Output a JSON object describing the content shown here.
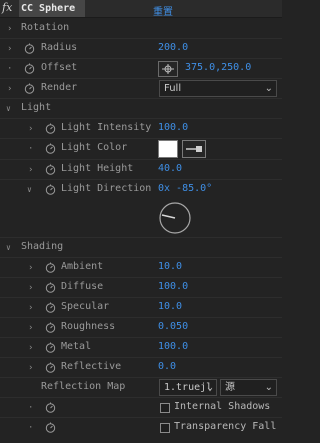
{
  "header": {
    "fx": "fx",
    "title": "CC Sphere",
    "reset": "重置"
  },
  "rotation": {
    "label": "Rotation"
  },
  "radius": {
    "label": "Radius",
    "value": "200.0"
  },
  "offset": {
    "label": "Offset",
    "value": "375.0,250.0"
  },
  "render": {
    "label": "Render",
    "value": "Full"
  },
  "light": {
    "label": "Light"
  },
  "light_intensity": {
    "label": "Light Intensity",
    "value": "100.0"
  },
  "light_color": {
    "label": "Light Color",
    "swatch": "#ffffff"
  },
  "light_height": {
    "label": "Light Height",
    "value": "40.0"
  },
  "light_direction": {
    "label": "Light Direction",
    "value": "0x -85.0°"
  },
  "shading": {
    "label": "Shading"
  },
  "ambient": {
    "label": "Ambient",
    "value": "10.0"
  },
  "diffuse": {
    "label": "Diffuse",
    "value": "100.0"
  },
  "specular": {
    "label": "Specular",
    "value": "10.0"
  },
  "roughness": {
    "label": "Roughness",
    "value": "0.050"
  },
  "metal": {
    "label": "Metal",
    "value": "100.0"
  },
  "reflective": {
    "label": "Reflective",
    "value": "0.0"
  },
  "reflection_map": {
    "label": "Reflection Map",
    "layer": "1.truejl",
    "source": "源"
  },
  "internal_shadows": {
    "label": "Internal Shadows"
  },
  "transparency_falloff": {
    "label": "Transparency Fall"
  }
}
